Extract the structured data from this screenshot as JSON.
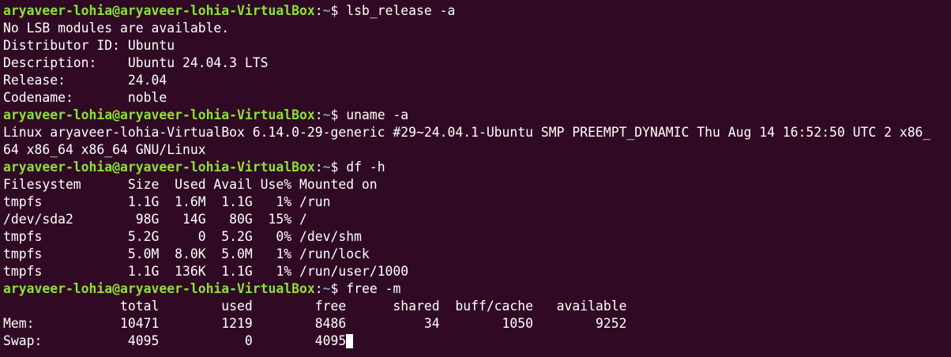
{
  "prompt": {
    "user_host": "aryaveer-lohia@aryaveer-lohia-VirtualBox",
    "sep": ":",
    "path": "~",
    "symbol": "$ "
  },
  "commands": [
    "lsb_release -a",
    "uname -a",
    "df -h",
    "free -m"
  ],
  "lsb_output": [
    "No LSB modules are available.",
    "Distributor ID: Ubuntu",
    "Description:    Ubuntu 24.04.3 LTS",
    "Release:        24.04",
    "Codename:       noble"
  ],
  "uname_output": [
    "Linux aryaveer-lohia-VirtualBox 6.14.0-29-generic #29~24.04.1-Ubuntu SMP PREEMPT_DYNAMIC Thu Aug 14 16:52:50 UTC 2 x86_",
    "64 x86_64 x86_64 GNU/Linux"
  ],
  "df_output": [
    "Filesystem      Size  Used Avail Use% Mounted on",
    "tmpfs           1.1G  1.6M  1.1G   1% /run",
    "/dev/sda2        98G   14G   80G  15% /",
    "tmpfs           5.2G     0  5.2G   0% /dev/shm",
    "tmpfs           5.0M  8.0K  5.0M   1% /run/lock",
    "tmpfs           1.1G  136K  1.1G   1% /run/user/1000"
  ],
  "free_output": [
    "               total        used        free      shared  buff/cache   available",
    "Mem:           10471        1219        8486          34        1050        9252",
    "Swap:           4095           0        4095"
  ],
  "colors": {
    "background": "#300a24",
    "user_host": "#8ae234",
    "path": "#729fcf",
    "text": "#ffffff"
  }
}
